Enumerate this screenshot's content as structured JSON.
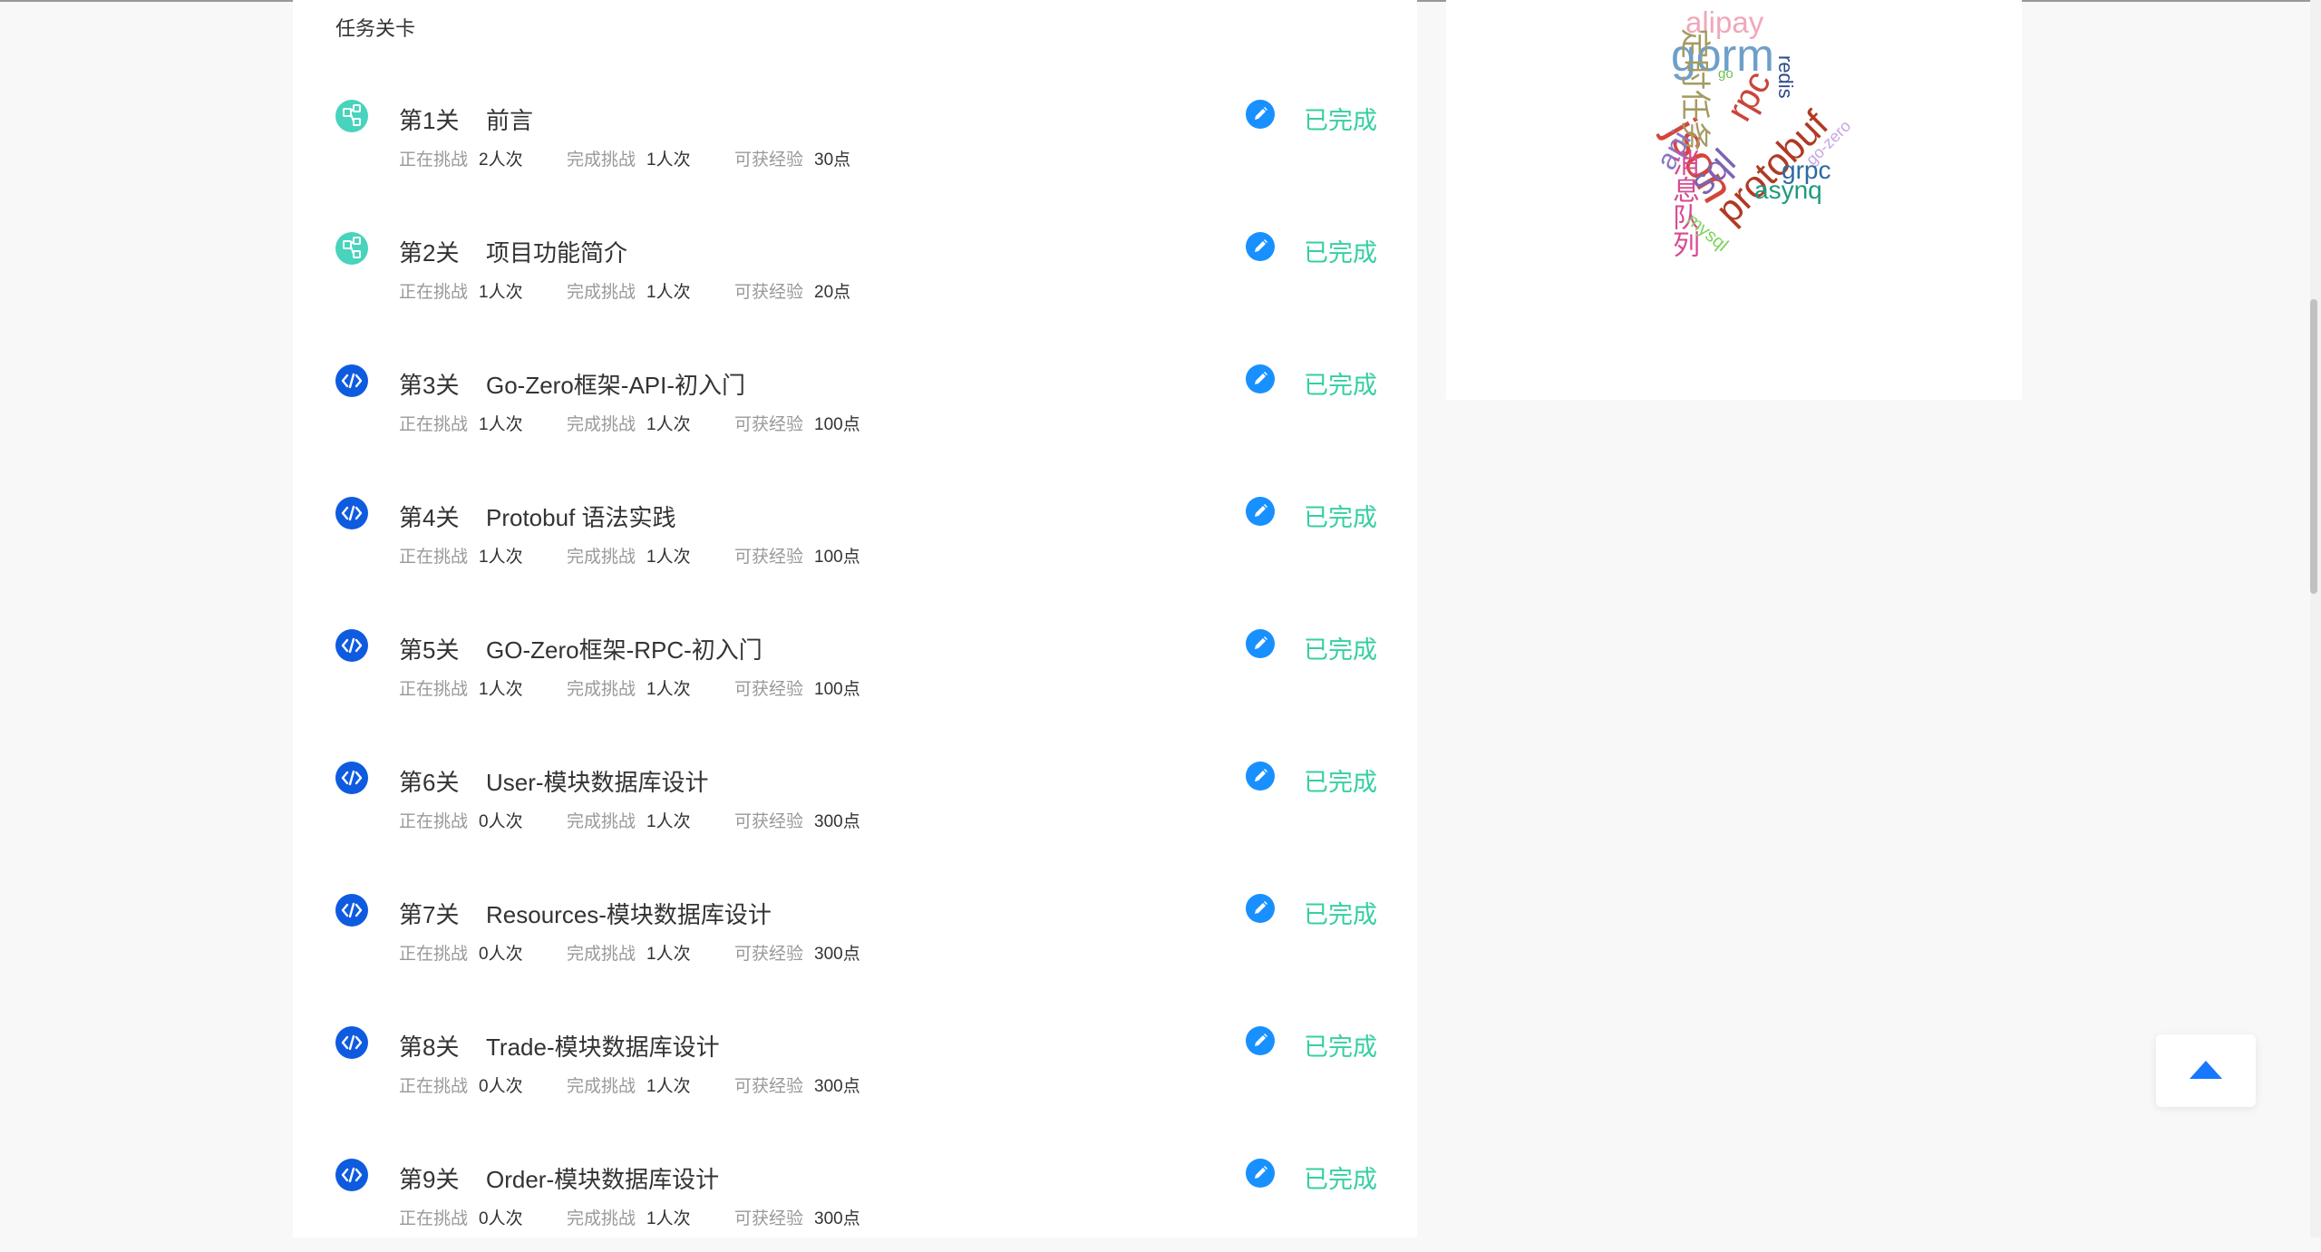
{
  "section_title": "任务关卡",
  "stages": [
    {
      "no": "第1关",
      "title": "前言",
      "icon": "share-nodes-icon",
      "icon_color": "#48d3bd",
      "challenging_label": "正在挑战",
      "challenging": "2人次",
      "completed_label": "完成挑战",
      "completed": "1人次",
      "exp_label": "可获经验",
      "exp": "30点",
      "status": "已完成"
    },
    {
      "no": "第2关",
      "title": "项目功能简介",
      "icon": "share-nodes-icon",
      "icon_color": "#48d3bd",
      "challenging_label": "正在挑战",
      "challenging": "1人次",
      "completed_label": "完成挑战",
      "completed": "1人次",
      "exp_label": "可获经验",
      "exp": "20点",
      "status": "已完成"
    },
    {
      "no": "第3关",
      "title": "Go-Zero框架-API-初入门",
      "icon": "code-icon",
      "icon_color": "#0e5be0",
      "challenging_label": "正在挑战",
      "challenging": "1人次",
      "completed_label": "完成挑战",
      "completed": "1人次",
      "exp_label": "可获经验",
      "exp": "100点",
      "status": "已完成"
    },
    {
      "no": "第4关",
      "title": "Protobuf 语法实践",
      "icon": "code-icon",
      "icon_color": "#0e5be0",
      "challenging_label": "正在挑战",
      "challenging": "1人次",
      "completed_label": "完成挑战",
      "completed": "1人次",
      "exp_label": "可获经验",
      "exp": "100点",
      "status": "已完成"
    },
    {
      "no": "第5关",
      "title": "GO-Zero框架-RPC-初入门",
      "icon": "code-icon",
      "icon_color": "#0e5be0",
      "challenging_label": "正在挑战",
      "challenging": "1人次",
      "completed_label": "完成挑战",
      "completed": "1人次",
      "exp_label": "可获经验",
      "exp": "100点",
      "status": "已完成"
    },
    {
      "no": "第6关",
      "title": "User-模块数据库设计",
      "icon": "code-icon",
      "icon_color": "#0e5be0",
      "challenging_label": "正在挑战",
      "challenging": "0人次",
      "completed_label": "完成挑战",
      "completed": "1人次",
      "exp_label": "可获经验",
      "exp": "300点",
      "status": "已完成"
    },
    {
      "no": "第7关",
      "title": "Resources-模块数据库设计",
      "icon": "code-icon",
      "icon_color": "#0e5be0",
      "challenging_label": "正在挑战",
      "challenging": "0人次",
      "completed_label": "完成挑战",
      "completed": "1人次",
      "exp_label": "可获经验",
      "exp": "300点",
      "status": "已完成"
    },
    {
      "no": "第8关",
      "title": "Trade-模块数据库设计",
      "icon": "code-icon",
      "icon_color": "#0e5be0",
      "challenging_label": "正在挑战",
      "challenging": "0人次",
      "completed_label": "完成挑战",
      "completed": "1人次",
      "exp_label": "可获经验",
      "exp": "300点",
      "status": "已完成"
    },
    {
      "no": "第9关",
      "title": "Order-模块数据库设计",
      "icon": "code-icon",
      "icon_color": "#0e5be0",
      "challenging_label": "正在挑战",
      "challenging": "0人次",
      "completed_label": "完成挑战",
      "completed": "1人次",
      "exp_label": "可获经验",
      "exp": "300点",
      "status": "已完成"
    }
  ],
  "word_cloud": {
    "words": [
      {
        "text": "alipay",
        "color": "#f0a8b8"
      },
      {
        "text": "gorm",
        "color": "#6e9fc9"
      },
      {
        "text": "json",
        "color": "#d2473b"
      },
      {
        "text": "定时任务",
        "color": "#a49b62"
      },
      {
        "text": "redis",
        "color": "#2e4a88"
      },
      {
        "text": "rpc",
        "color": "#c9453b"
      },
      {
        "text": "go",
        "color": "#6cc24a"
      },
      {
        "text": "protobuf",
        "color": "#b03a24"
      },
      {
        "text": "sql",
        "color": "#7d62b3"
      },
      {
        "text": "api",
        "color": "#8a76c6"
      },
      {
        "text": "go-zero",
        "color": "#c6a6e0"
      },
      {
        "text": "grpc",
        "color": "#2d6a9f"
      },
      {
        "text": "asynq",
        "color": "#1f9a7e"
      },
      {
        "text": "消息队列",
        "color": "#d64a92"
      },
      {
        "text": "mysql",
        "color": "#7ad35a"
      }
    ]
  },
  "back_to_top_icon": "caret-up-icon",
  "colors": {
    "done": "#35cfa2",
    "edit": "#1890ff"
  }
}
